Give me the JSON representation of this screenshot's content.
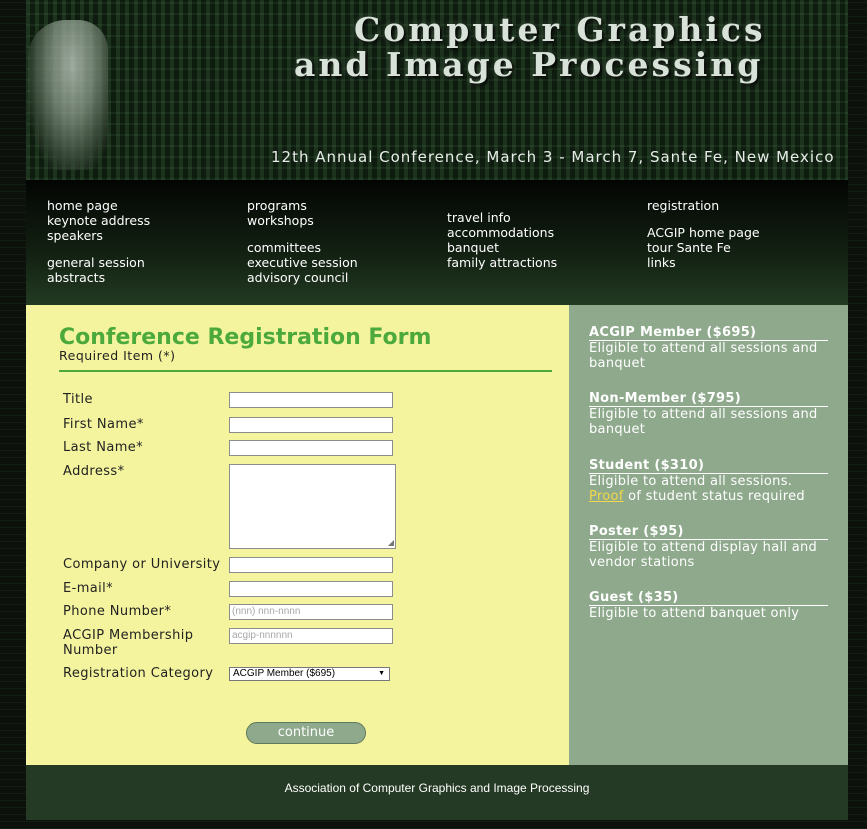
{
  "banner": {
    "title_line1": "Computer Graphics",
    "title_line2": "and Image Processing",
    "subtitle": "12th Annual Conference, March 3 - March 7, Sante Fe, New Mexico"
  },
  "nav": {
    "col1": [
      "home page",
      "keynote address",
      "speakers",
      "general session",
      "abstracts"
    ],
    "col2": [
      "programs",
      "workshops",
      "committees",
      "executive session",
      "advisory council"
    ],
    "col3": [
      "travel info",
      "accommodations",
      "banquet",
      "family attractions"
    ],
    "col4": [
      "registration",
      "ACGIP home page",
      "tour Sante Fe",
      "links"
    ]
  },
  "form": {
    "title": "Conference Registration Form",
    "required_note": "Required Item (*)",
    "labels": {
      "title": "Title",
      "first_name": "First Name*",
      "last_name": "Last Name*",
      "address": "Address*",
      "company": "Company or University",
      "email": "E-mail*",
      "phone": "Phone Number*",
      "membership_line1": "ACGIP Membership",
      "membership_line2": "Number",
      "category": "Registration Category"
    },
    "placeholders": {
      "phone": "(nnn) nnn-nnnn",
      "membership": "acgip-nnnnnn"
    },
    "category_selected": "ACGIP Member ($695)",
    "continue_label": "continue"
  },
  "options": [
    {
      "title": "ACGIP Member ($695)",
      "desc": "Eligible to attend all sessions and banquet"
    },
    {
      "title": "Non-Member ($795)",
      "desc": "Eligible to attend all sessions and banquet"
    },
    {
      "title": "Student ($310)",
      "desc": "Eligible to attend all sessions.",
      "link": "Proof",
      "link_suffix": " of student status required"
    },
    {
      "title": "Poster ($95)",
      "desc": "Eligible to attend display hall and vendor stations"
    },
    {
      "title": "Guest ($35)",
      "desc": "Eligible to attend banquet only"
    }
  ],
  "footer": {
    "text": "Association of Computer Graphics and Image Processing"
  },
  "colors": {
    "form_bg": "#f4f49e",
    "side_bg": "#8ea98c",
    "heading_green": "#4ca93c",
    "footer_bg": "#243a24",
    "link_yellow": "#f2d84a"
  }
}
